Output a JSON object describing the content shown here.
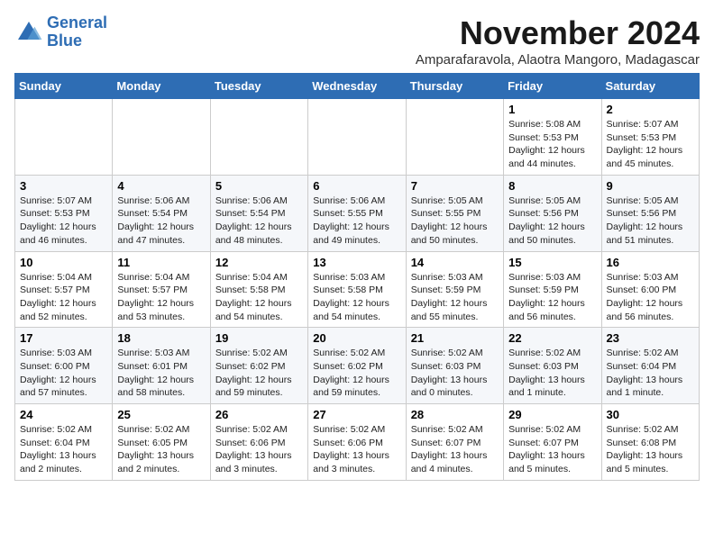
{
  "logo": {
    "line1": "General",
    "line2": "Blue"
  },
  "title": "November 2024",
  "location": "Amparafaravola, Alaotra Mangoro, Madagascar",
  "weekdays": [
    "Sunday",
    "Monday",
    "Tuesday",
    "Wednesday",
    "Thursday",
    "Friday",
    "Saturday"
  ],
  "weeks": [
    [
      {
        "day": "",
        "content": ""
      },
      {
        "day": "",
        "content": ""
      },
      {
        "day": "",
        "content": ""
      },
      {
        "day": "",
        "content": ""
      },
      {
        "day": "",
        "content": ""
      },
      {
        "day": "1",
        "content": "Sunrise: 5:08 AM\nSunset: 5:53 PM\nDaylight: 12 hours\nand 44 minutes."
      },
      {
        "day": "2",
        "content": "Sunrise: 5:07 AM\nSunset: 5:53 PM\nDaylight: 12 hours\nand 45 minutes."
      }
    ],
    [
      {
        "day": "3",
        "content": "Sunrise: 5:07 AM\nSunset: 5:53 PM\nDaylight: 12 hours\nand 46 minutes."
      },
      {
        "day": "4",
        "content": "Sunrise: 5:06 AM\nSunset: 5:54 PM\nDaylight: 12 hours\nand 47 minutes."
      },
      {
        "day": "5",
        "content": "Sunrise: 5:06 AM\nSunset: 5:54 PM\nDaylight: 12 hours\nand 48 minutes."
      },
      {
        "day": "6",
        "content": "Sunrise: 5:06 AM\nSunset: 5:55 PM\nDaylight: 12 hours\nand 49 minutes."
      },
      {
        "day": "7",
        "content": "Sunrise: 5:05 AM\nSunset: 5:55 PM\nDaylight: 12 hours\nand 50 minutes."
      },
      {
        "day": "8",
        "content": "Sunrise: 5:05 AM\nSunset: 5:56 PM\nDaylight: 12 hours\nand 50 minutes."
      },
      {
        "day": "9",
        "content": "Sunrise: 5:05 AM\nSunset: 5:56 PM\nDaylight: 12 hours\nand 51 minutes."
      }
    ],
    [
      {
        "day": "10",
        "content": "Sunrise: 5:04 AM\nSunset: 5:57 PM\nDaylight: 12 hours\nand 52 minutes."
      },
      {
        "day": "11",
        "content": "Sunrise: 5:04 AM\nSunset: 5:57 PM\nDaylight: 12 hours\nand 53 minutes."
      },
      {
        "day": "12",
        "content": "Sunrise: 5:04 AM\nSunset: 5:58 PM\nDaylight: 12 hours\nand 54 minutes."
      },
      {
        "day": "13",
        "content": "Sunrise: 5:03 AM\nSunset: 5:58 PM\nDaylight: 12 hours\nand 54 minutes."
      },
      {
        "day": "14",
        "content": "Sunrise: 5:03 AM\nSunset: 5:59 PM\nDaylight: 12 hours\nand 55 minutes."
      },
      {
        "day": "15",
        "content": "Sunrise: 5:03 AM\nSunset: 5:59 PM\nDaylight: 12 hours\nand 56 minutes."
      },
      {
        "day": "16",
        "content": "Sunrise: 5:03 AM\nSunset: 6:00 PM\nDaylight: 12 hours\nand 56 minutes."
      }
    ],
    [
      {
        "day": "17",
        "content": "Sunrise: 5:03 AM\nSunset: 6:00 PM\nDaylight: 12 hours\nand 57 minutes."
      },
      {
        "day": "18",
        "content": "Sunrise: 5:03 AM\nSunset: 6:01 PM\nDaylight: 12 hours\nand 58 minutes."
      },
      {
        "day": "19",
        "content": "Sunrise: 5:02 AM\nSunset: 6:02 PM\nDaylight: 12 hours\nand 59 minutes."
      },
      {
        "day": "20",
        "content": "Sunrise: 5:02 AM\nSunset: 6:02 PM\nDaylight: 12 hours\nand 59 minutes."
      },
      {
        "day": "21",
        "content": "Sunrise: 5:02 AM\nSunset: 6:03 PM\nDaylight: 13 hours\nand 0 minutes."
      },
      {
        "day": "22",
        "content": "Sunrise: 5:02 AM\nSunset: 6:03 PM\nDaylight: 13 hours\nand 1 minute."
      },
      {
        "day": "23",
        "content": "Sunrise: 5:02 AM\nSunset: 6:04 PM\nDaylight: 13 hours\nand 1 minute."
      }
    ],
    [
      {
        "day": "24",
        "content": "Sunrise: 5:02 AM\nSunset: 6:04 PM\nDaylight: 13 hours\nand 2 minutes."
      },
      {
        "day": "25",
        "content": "Sunrise: 5:02 AM\nSunset: 6:05 PM\nDaylight: 13 hours\nand 2 minutes."
      },
      {
        "day": "26",
        "content": "Sunrise: 5:02 AM\nSunset: 6:06 PM\nDaylight: 13 hours\nand 3 minutes."
      },
      {
        "day": "27",
        "content": "Sunrise: 5:02 AM\nSunset: 6:06 PM\nDaylight: 13 hours\nand 3 minutes."
      },
      {
        "day": "28",
        "content": "Sunrise: 5:02 AM\nSunset: 6:07 PM\nDaylight: 13 hours\nand 4 minutes."
      },
      {
        "day": "29",
        "content": "Sunrise: 5:02 AM\nSunset: 6:07 PM\nDaylight: 13 hours\nand 5 minutes."
      },
      {
        "day": "30",
        "content": "Sunrise: 5:02 AM\nSunset: 6:08 PM\nDaylight: 13 hours\nand 5 minutes."
      }
    ]
  ]
}
